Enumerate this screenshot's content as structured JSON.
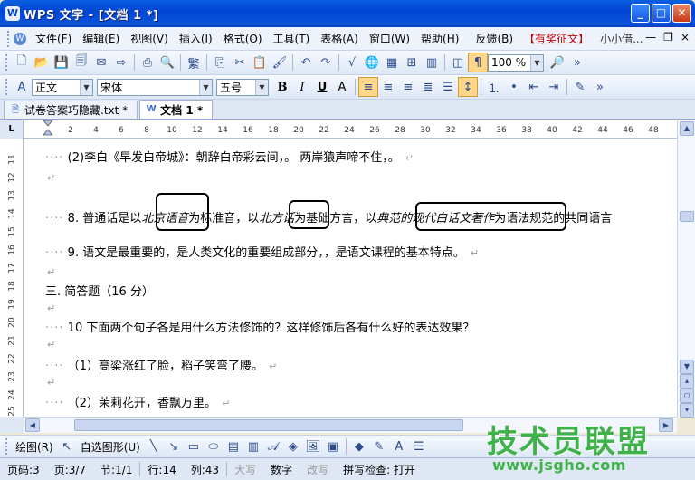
{
  "window": {
    "title": "WPS 文字 - [文档 1 *]",
    "app_icon": "W"
  },
  "menubar": {
    "items": [
      "文件(F)",
      "编辑(E)",
      "视图(V)",
      "插入(I)",
      "格式(O)",
      "工具(T)",
      "表格(A)",
      "窗口(W)",
      "帮助(H)"
    ],
    "feedback": "反馈(B)",
    "promo": "【有奖征文】",
    "user": "小小借...",
    "right_controls": [
      "—",
      "❐",
      "×"
    ]
  },
  "formatting": {
    "style": "正文",
    "font": "宋体",
    "size": "五号",
    "zoom": "100 %"
  },
  "tabs": [
    {
      "label": "试卷答案巧隐藏.txt *",
      "active": false
    },
    {
      "label": "文档 1 *",
      "active": true
    }
  ],
  "ruler": {
    "corner": "L",
    "h_ticks": [
      "2",
      "4",
      "6",
      "8",
      "10",
      "12",
      "14",
      "16",
      "18",
      "20",
      "22",
      "24",
      "26",
      "28",
      "30",
      "32",
      "34",
      "36",
      "38",
      "40",
      "42",
      "44",
      "46",
      "48"
    ],
    "v_ticks": [
      "11",
      "12",
      "13",
      "14",
      "15",
      "16",
      "17",
      "18",
      "19",
      "20",
      "21",
      "22",
      "23",
      "24",
      "25"
    ]
  },
  "document": {
    "line1": "(2)李白《早发白帝城》：朝辞白帝彩云间，。 两岸猿声啼不住，。",
    "line2_pre": "8. 普通话是以",
    "line2_i1": "北京语音",
    "line2_mid1": "为标准音，以",
    "line2_i2": "北方话",
    "line2_mid2": "为基础方言，以",
    "line2_i3": "典范的现代白话文著作",
    "line2_post": "为语法规范的共同语言",
    "line3": "9. 语文是最重要的，是人类文化的重要组成部分，，是语文课程的基本特点。",
    "heading": "三. 简答题（16 分）",
    "line4": "10 下面两个句子各是用什么方法修饰的？这样修饰后各有什么好的表达效果？",
    "line5": "（1）高粱涨红了脸，稻子笑弯了腰。",
    "line6": "（2）茉莉花开，香飘万里。",
    "para_mark": "↵",
    "lead_dots": "····"
  },
  "drawbar": {
    "draw_label": "绘图(R)",
    "autoshapes_label": "自选图形(U)"
  },
  "statusbar": {
    "page_code": "页码:3",
    "page": "页:3/7",
    "section": "节:1/1",
    "row": "行:14",
    "col": "列:43",
    "caps": "大写",
    "num": "数字",
    "overwrite": "改写",
    "spellcheck": "拼写检查: 打开"
  },
  "watermark": {
    "text": "技术员联盟",
    "url": "www.jsgho.com"
  }
}
